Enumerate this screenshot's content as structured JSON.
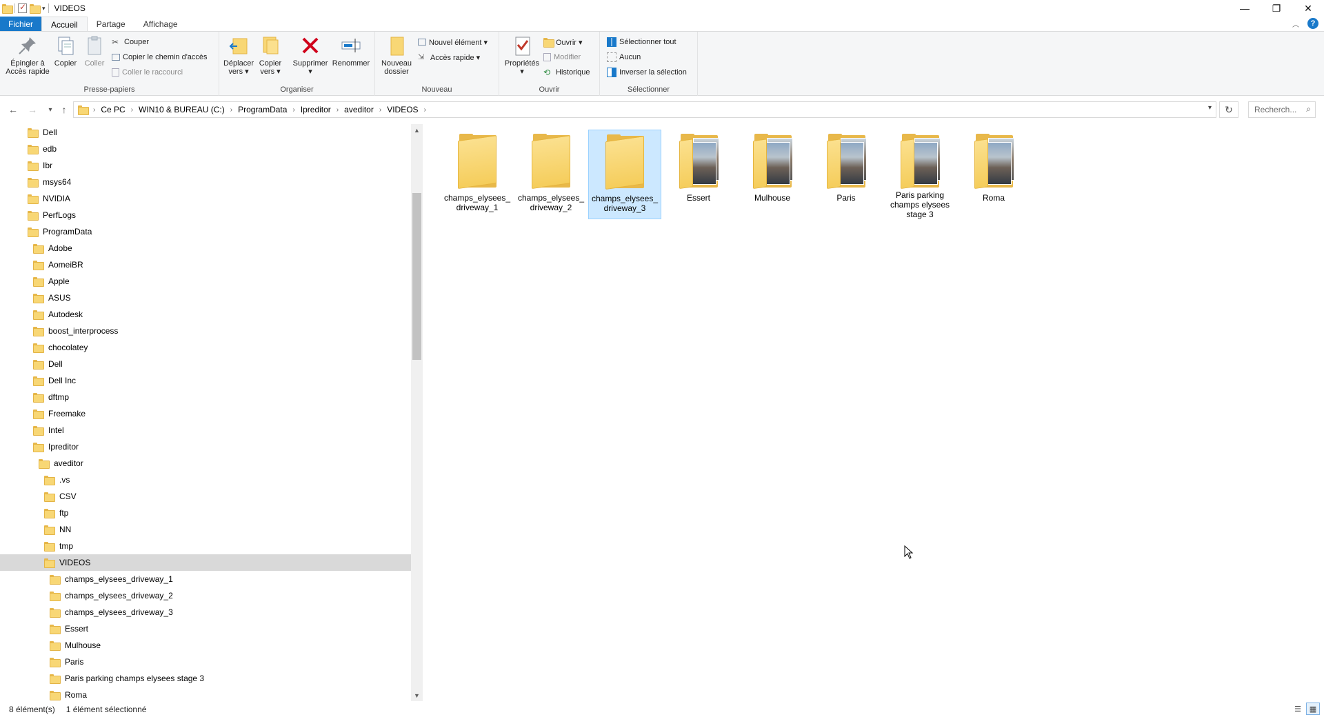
{
  "window": {
    "title": "VIDEOS",
    "controls": {
      "minimize": "—",
      "maximize": "❐",
      "close": "✕"
    }
  },
  "ribbon_tabs": [
    {
      "label": "Fichier"
    },
    {
      "label": "Accueil"
    },
    {
      "label": "Partage"
    },
    {
      "label": "Affichage"
    }
  ],
  "ribbon": {
    "presse_papiers": {
      "name": "Presse-papiers",
      "pin_l1": "Épingler à",
      "pin_l2": "Accès rapide",
      "copy": "Copier",
      "paste": "Coller",
      "cut": "Couper",
      "copy_path": "Copier le chemin d'accès",
      "paste_shortcut": "Coller le raccourci"
    },
    "organiser": {
      "name": "Organiser",
      "move_l1": "Déplacer",
      "move_l2": "vers ▾",
      "copyto_l1": "Copier",
      "copyto_l2": "vers ▾",
      "delete": "Supprimer",
      "delete_caret": "▾",
      "rename": "Renommer"
    },
    "nouveau": {
      "name": "Nouveau",
      "new_folder_l1": "Nouveau",
      "new_folder_l2": "dossier",
      "new_item": "Nouvel élément ▾",
      "easy_access": "Accès rapide ▾"
    },
    "ouvrir": {
      "name": "Ouvrir",
      "properties": "Propriétés",
      "properties_caret": "▾",
      "open": "Ouvrir ▾",
      "edit": "Modifier",
      "history": "Historique"
    },
    "selectionner": {
      "name": "Sélectionner",
      "select_all": "Sélectionner tout",
      "select_none": "Aucun",
      "invert": "Inverser la sélection"
    }
  },
  "address": {
    "crumbs": [
      "Ce PC",
      "WIN10 & BUREAU (C:)",
      "ProgramData",
      "Ipreditor",
      "aveditor",
      "VIDEOS"
    ],
    "search_placeholder": "Recherch..."
  },
  "tree": [
    {
      "label": "Dell",
      "indent": 0
    },
    {
      "label": "edb",
      "indent": 0
    },
    {
      "label": "Ibr",
      "indent": 0
    },
    {
      "label": "msys64",
      "indent": 0
    },
    {
      "label": "NVIDIA",
      "indent": 0
    },
    {
      "label": "PerfLogs",
      "indent": 0
    },
    {
      "label": "ProgramData",
      "indent": 0
    },
    {
      "label": "Adobe",
      "indent": 1
    },
    {
      "label": "AomeiBR",
      "indent": 1
    },
    {
      "label": "Apple",
      "indent": 1
    },
    {
      "label": "ASUS",
      "indent": 1
    },
    {
      "label": "Autodesk",
      "indent": 1
    },
    {
      "label": "boost_interprocess",
      "indent": 1
    },
    {
      "label": "chocolatey",
      "indent": 1
    },
    {
      "label": "Dell",
      "indent": 1
    },
    {
      "label": "Dell Inc",
      "indent": 1
    },
    {
      "label": "dftmp",
      "indent": 1
    },
    {
      "label": "Freemake",
      "indent": 1
    },
    {
      "label": "Intel",
      "indent": 1
    },
    {
      "label": "Ipreditor",
      "indent": 1
    },
    {
      "label": "aveditor",
      "indent": 2
    },
    {
      "label": ".vs",
      "indent": 3
    },
    {
      "label": "CSV",
      "indent": 3
    },
    {
      "label": "ftp",
      "indent": 3
    },
    {
      "label": "NN",
      "indent": 3
    },
    {
      "label": "tmp",
      "indent": 3
    },
    {
      "label": "VIDEOS",
      "indent": 3,
      "selected": true
    },
    {
      "label": "champs_elysees_driveway_1",
      "indent": 4
    },
    {
      "label": "champs_elysees_driveway_2",
      "indent": 4
    },
    {
      "label": "champs_elysees_driveway_3",
      "indent": 4
    },
    {
      "label": "Essert",
      "indent": 4
    },
    {
      "label": "Mulhouse",
      "indent": 4
    },
    {
      "label": "Paris",
      "indent": 4
    },
    {
      "label": "Paris parking champs elysees stage 3",
      "indent": 4
    },
    {
      "label": "Roma",
      "indent": 4
    }
  ],
  "files": [
    {
      "l1": "champs_elysees_",
      "l2": "driveway_1",
      "l3": "",
      "thumb": false,
      "selected": false
    },
    {
      "l1": "champs_elysees_",
      "l2": "driveway_2",
      "l3": "",
      "thumb": false,
      "selected": false
    },
    {
      "l1": "champs_elysees_",
      "l2": "driveway_3",
      "l3": "",
      "thumb": false,
      "selected": true
    },
    {
      "l1": "Essert",
      "l2": "",
      "l3": "",
      "thumb": true,
      "selected": false
    },
    {
      "l1": "Mulhouse",
      "l2": "",
      "l3": "",
      "thumb": true,
      "selected": false
    },
    {
      "l1": "Paris",
      "l2": "",
      "l3": "",
      "thumb": true,
      "selected": false
    },
    {
      "l1": "Paris parking",
      "l2": "champs elysees",
      "l3": "stage 3",
      "thumb": true,
      "selected": false
    },
    {
      "l1": "Roma",
      "l2": "",
      "l3": "",
      "thumb": true,
      "selected": false
    }
  ],
  "status": {
    "count": "8 élément(s)",
    "selection": "1 élément sélectionné"
  },
  "colors": {
    "accent": "#1979ca",
    "selection": "#cce8ff",
    "folder": "#f8d775"
  }
}
